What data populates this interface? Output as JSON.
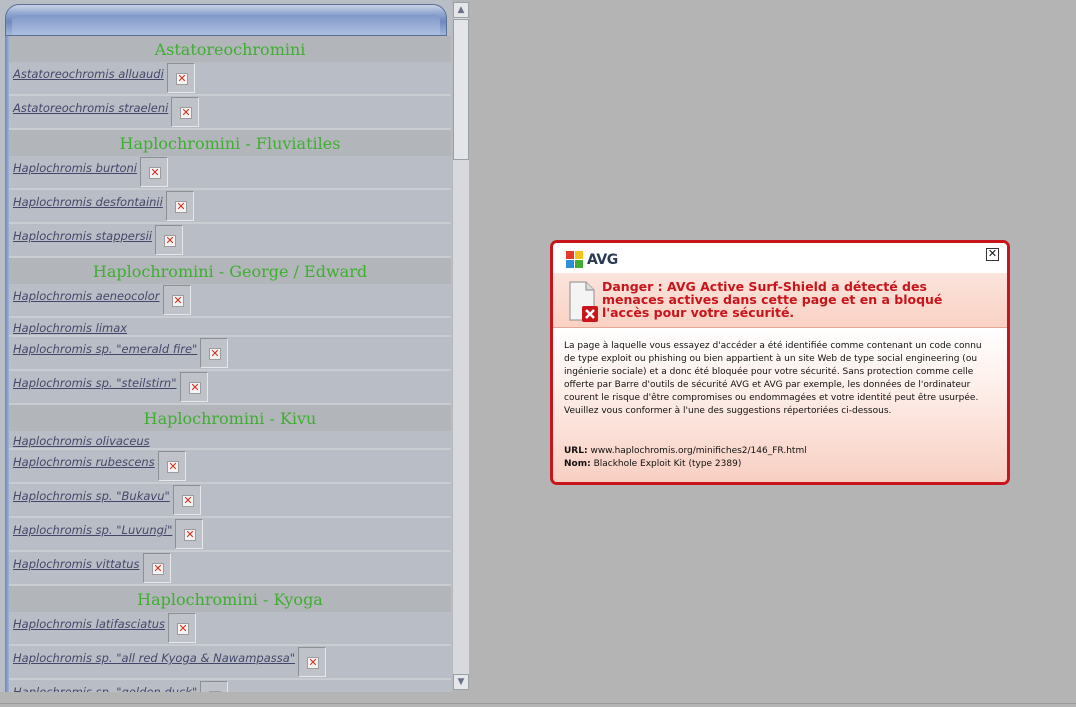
{
  "sections": [
    {
      "title": "Astatoreochromini",
      "items": [
        {
          "name": "Astatoreochromis alluaudi",
          "image": true
        },
        {
          "name": "Astatoreochromis straeleni",
          "image": true
        }
      ]
    },
    {
      "title": "Haplochromini - Fluviatiles",
      "items": [
        {
          "name": "Haplochromis burtoni",
          "image": true
        },
        {
          "name": "Haplochromis desfontainii",
          "image": true
        },
        {
          "name": "Haplochromis stappersii",
          "image": true
        }
      ]
    },
    {
      "title": "Haplochromini - George / Edward",
      "items": [
        {
          "name": "Haplochromis aeneocolor",
          "image": true
        },
        {
          "name": "Haplochromis limax",
          "image": false
        },
        {
          "name": "Haplochromis sp. \"emerald fire\"",
          "image": true
        },
        {
          "name": "Haplochromis sp. \"steilstirn\"",
          "image": true
        }
      ]
    },
    {
      "title": "Haplochromini - Kivu",
      "items": [
        {
          "name": "Haplochromis olivaceus",
          "image": false
        },
        {
          "name": "Haplochromis rubescens",
          "image": true
        },
        {
          "name": "Haplochromis sp. \"Bukavu\"",
          "image": true
        },
        {
          "name": "Haplochromis sp. \"Luvungi\"",
          "image": true
        },
        {
          "name": "Haplochromis vittatus",
          "image": true
        }
      ]
    },
    {
      "title": "Haplochromini - Kyoga",
      "items": [
        {
          "name": "Haplochromis latifasciatus",
          "image": true
        },
        {
          "name": "Haplochromis sp. \"all red Kyoga & Nawampassa\"",
          "image": true
        },
        {
          "name": "Haplochromis sp. \"golden duck\"",
          "image": true
        }
      ]
    }
  ],
  "scrollbar": {
    "up_glyph": "▲",
    "down_glyph": "▼"
  },
  "broken_image_glyph": "✕",
  "dialog": {
    "brand": "AVG",
    "close_glyph": "✕",
    "title": "Danger : AVG Active Surf-Shield a détecté des menaces actives dans cette page et en a bloqué l'accès pour votre sécurité.",
    "body": "La page à laquelle vous essayez d'accéder a été identifiée comme contenant un code connu de type exploit ou phishing ou bien appartient à un site Web de type social engineering (ou ingénierie sociale) et a donc été bloquée pour votre sécurité. Sans protection comme celle offerte par Barre d'outils de sécurité AVG et AVG par exemple, les données de l'ordinateur courent le risque d'être compromises ou endommagées et votre identité peut être usurpée. Veuillez vous conformer à l'une des suggestions répertoriées ci-dessous.",
    "url_label": "URL:",
    "url_value": "www.haplochromis.org/minifiches2/146_FR.html",
    "name_label": "Nom:",
    "name_value": "Blackhole Exploit Kit (type 2389)",
    "colors": {
      "border": "#c8151b",
      "title": "#c8151b"
    }
  },
  "colors": {
    "section_header_text": "#3fae32",
    "link": "#45476a",
    "background": "#b4b4b4"
  }
}
